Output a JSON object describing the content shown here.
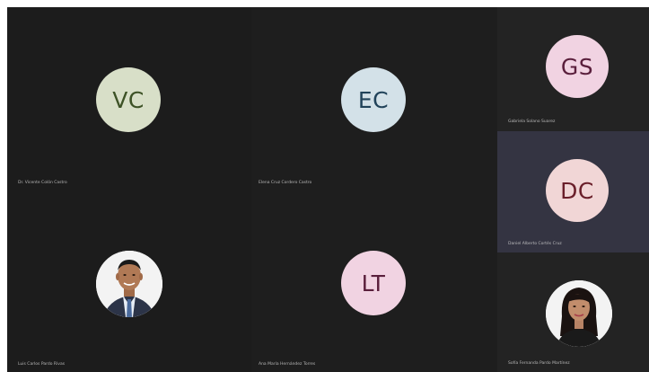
{
  "participants": [
    {
      "initials": "VC",
      "name": "Dr. Vicente Colón Castro",
      "avatar_bg": "#d8dfc8",
      "initials_color": "#3d5226",
      "tile_bg": "#1c1c1c"
    },
    {
      "initials": "EC",
      "name": "Elena Cruz Cordero Castro",
      "avatar_bg": "#d3e1e8",
      "initials_color": "#21435a",
      "tile_bg": "#1e1e1e"
    },
    {
      "initials": "GS",
      "name": "Gabriela Solano Suarez",
      "avatar_bg": "#f1d3e2",
      "initials_color": "#5a1f3c",
      "tile_bg": "#232323"
    },
    {
      "initials": "DC",
      "name": "Daniel Alberto Cortés Cruz",
      "avatar_bg": "#f1d6d6",
      "initials_color": "#6a1f2a",
      "tile_bg": "#343442"
    },
    {
      "initials": "",
      "name": "Luis Carlos Pardo Rivas",
      "avatar_bg": "#f3f3f3",
      "initials_color": "#000000",
      "tile_bg": "#1c1c1c",
      "has_photo": true
    },
    {
      "initials": "LT",
      "name": "Ana María Hernández Torres",
      "avatar_bg": "#f1d3e2",
      "initials_color": "#5a1f3c",
      "tile_bg": "#1e1e1e"
    },
    {
      "initials": "",
      "name": "Sofía Fernanda Pardo Martínez",
      "avatar_bg": "#f3f3f3",
      "initials_color": "#000000",
      "tile_bg": "#232323",
      "has_photo": true
    }
  ]
}
